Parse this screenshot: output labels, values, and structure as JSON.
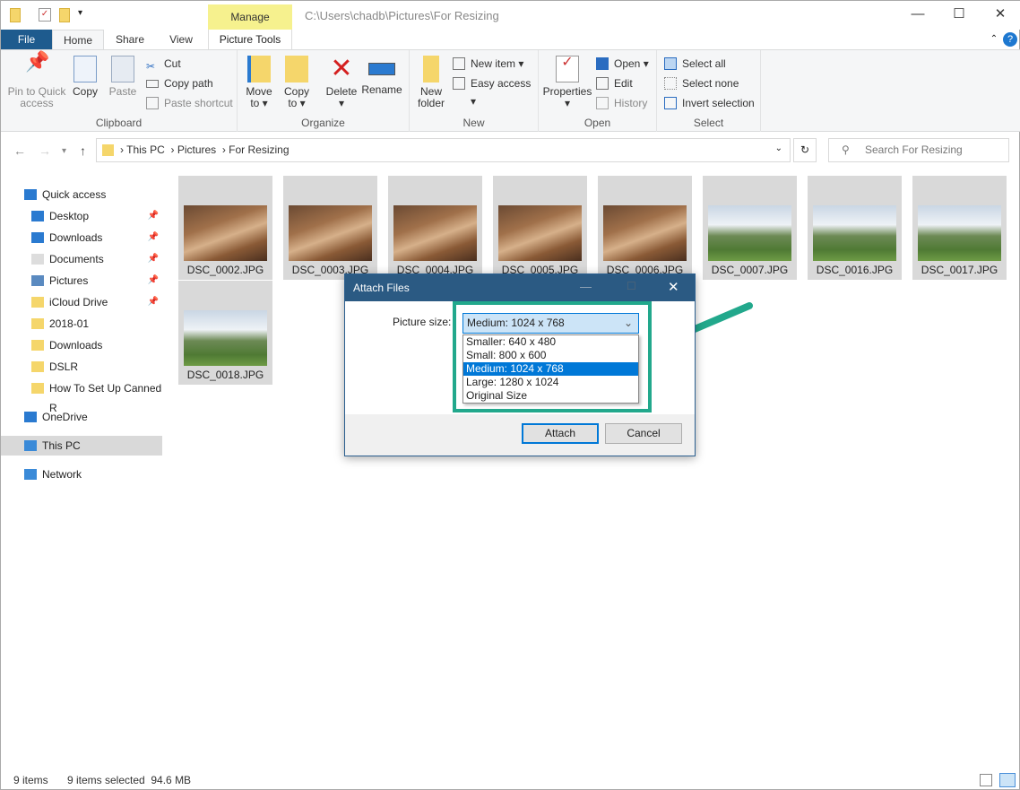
{
  "window": {
    "path": "C:\\Users\\chadb\\Pictures\\For Resizing",
    "context_tab": "Manage",
    "context_group": "Picture Tools"
  },
  "tabs": [
    "File",
    "Home",
    "Share",
    "View"
  ],
  "ribbon": {
    "clipboard": {
      "label": "Clipboard",
      "pin": "Pin to Quick access",
      "copy": "Copy",
      "paste": "Paste",
      "cut": "Cut",
      "copy_path": "Copy path",
      "paste_shortcut": "Paste shortcut"
    },
    "organize": {
      "label": "Organize",
      "move_to": "Move to",
      "copy_to": "Copy to",
      "delete": "Delete",
      "rename": "Rename"
    },
    "new": {
      "label": "New",
      "new_folder": "New folder",
      "new_item": "New item",
      "easy_access": "Easy access"
    },
    "open": {
      "label": "Open",
      "properties": "Properties",
      "open": "Open",
      "edit": "Edit",
      "history": "History"
    },
    "select": {
      "label": "Select",
      "select_all": "Select all",
      "select_none": "Select none",
      "invert": "Invert selection"
    }
  },
  "address": {
    "crumbs": [
      "This PC",
      "Pictures",
      "For Resizing"
    ],
    "search_placeholder": "Search For Resizing"
  },
  "sidebar": [
    {
      "label": "Quick access",
      "top": true,
      "pinned": false,
      "icon": "star-icon"
    },
    {
      "label": "Desktop",
      "pinned": true,
      "icon": "desktop-icon"
    },
    {
      "label": "Downloads",
      "pinned": true,
      "icon": "download-icon"
    },
    {
      "label": "Documents",
      "pinned": true,
      "icon": "document-icon"
    },
    {
      "label": "Pictures",
      "pinned": true,
      "icon": "pictures-icon"
    },
    {
      "label": "iCloud Drive",
      "pinned": true,
      "icon": "folder-icon"
    },
    {
      "label": "2018-01",
      "pinned": false,
      "icon": "folder-icon"
    },
    {
      "label": "Downloads",
      "pinned": false,
      "icon": "folder-icon"
    },
    {
      "label": "DSLR",
      "pinned": false,
      "icon": "folder-icon"
    },
    {
      "label": "How To Set Up Canned R",
      "pinned": false,
      "icon": "folder-icon"
    },
    {
      "label": "OneDrive",
      "top": true,
      "icon": "cloud-icon"
    },
    {
      "label": "This PC",
      "top": true,
      "selected": true,
      "icon": "computer-icon"
    },
    {
      "label": "Network",
      "top": true,
      "icon": "network-icon"
    }
  ],
  "files": [
    {
      "name": "DSC_0002.JPG",
      "kind": "dog"
    },
    {
      "name": "DSC_0003.JPG",
      "kind": "dog"
    },
    {
      "name": "DSC_0004.JPG",
      "kind": "dog"
    },
    {
      "name": "DSC_0005.JPG",
      "kind": "dog"
    },
    {
      "name": "DSC_0006.JPG",
      "kind": "dog"
    },
    {
      "name": "DSC_0007.JPG",
      "kind": "land"
    },
    {
      "name": "DSC_0016.JPG",
      "kind": "land"
    },
    {
      "name": "DSC_0017.JPG",
      "kind": "land"
    },
    {
      "name": "DSC_0018.JPG",
      "kind": "land"
    }
  ],
  "status": {
    "count": "9 items",
    "selected": "9 items selected  94.6 MB"
  },
  "dialog": {
    "title": "Attach Files",
    "label": "Picture size:",
    "selected": "Medium: 1024 x 768",
    "options": [
      "Smaller: 640 x 480",
      "Small: 800 x 600",
      "Medium: 1024 x 768",
      "Large: 1280 x 1024",
      "Original Size"
    ],
    "attach": "Attach",
    "cancel": "Cancel"
  },
  "colors": {
    "accent": "#0078d7",
    "highlight": "#22a88c",
    "file_tab": "#1e5b8e"
  }
}
